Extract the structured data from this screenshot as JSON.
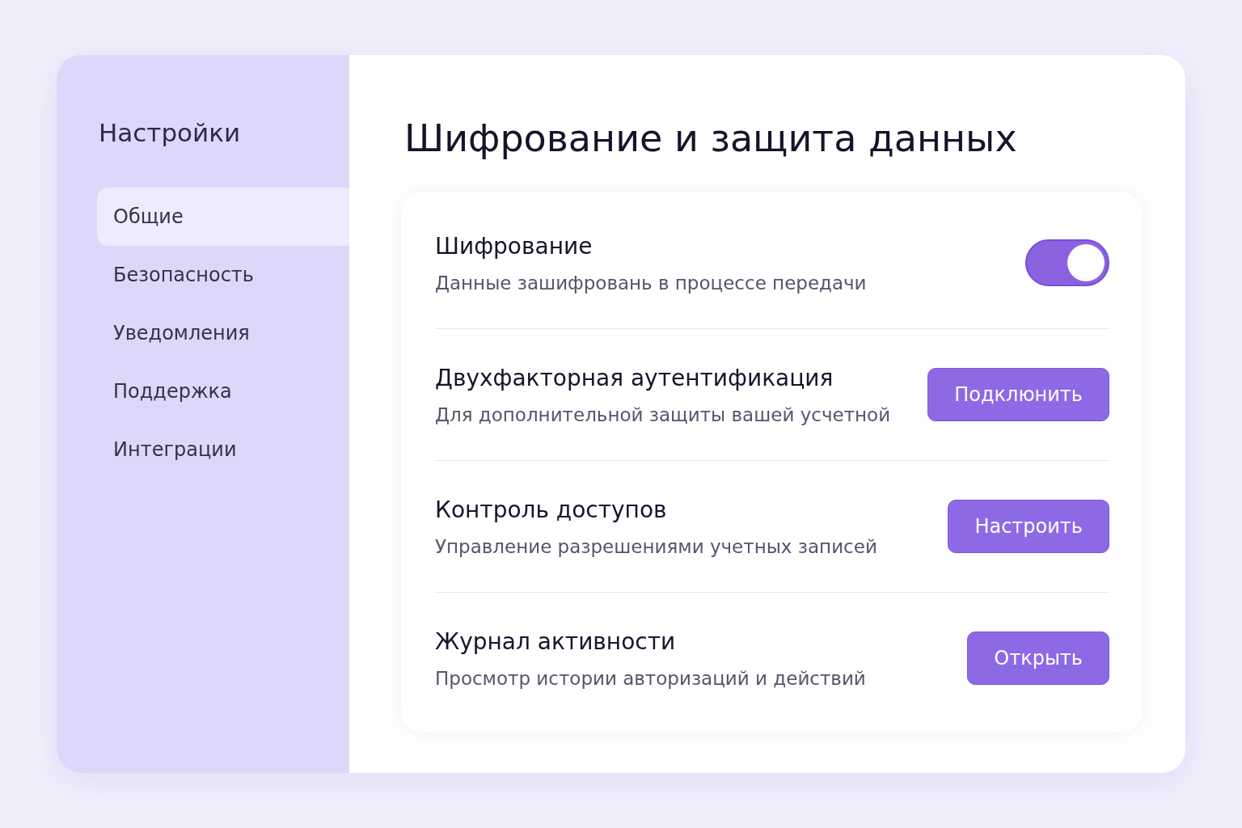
{
  "sidebar": {
    "title": "Настройки",
    "items": [
      {
        "label": "Общие",
        "selected": true
      },
      {
        "label": "Безопасность",
        "selected": false
      },
      {
        "label": "Уведомления",
        "selected": false
      },
      {
        "label": "Поддержка",
        "selected": false
      },
      {
        "label": "Интеграции",
        "selected": false
      }
    ]
  },
  "main": {
    "heading": "Шифрование и защита данных",
    "settings": [
      {
        "kind": "toggle",
        "title": "Шифрование",
        "description": "Данные зашифровань в процессе передачи",
        "on": true
      },
      {
        "kind": "button",
        "title": "Двухфакторная аутентификация",
        "description": "Для дополнительной защиты вашей усчетной",
        "button": "Подклюнить"
      },
      {
        "kind": "button",
        "title": "Контроль доступов",
        "description": "Управление разрешениями учетных записей",
        "button": "Настроить"
      },
      {
        "kind": "button",
        "title": "Журнал активности",
        "description": "Просмотр истории авторизаций и действий",
        "button": "Открыть"
      }
    ]
  }
}
